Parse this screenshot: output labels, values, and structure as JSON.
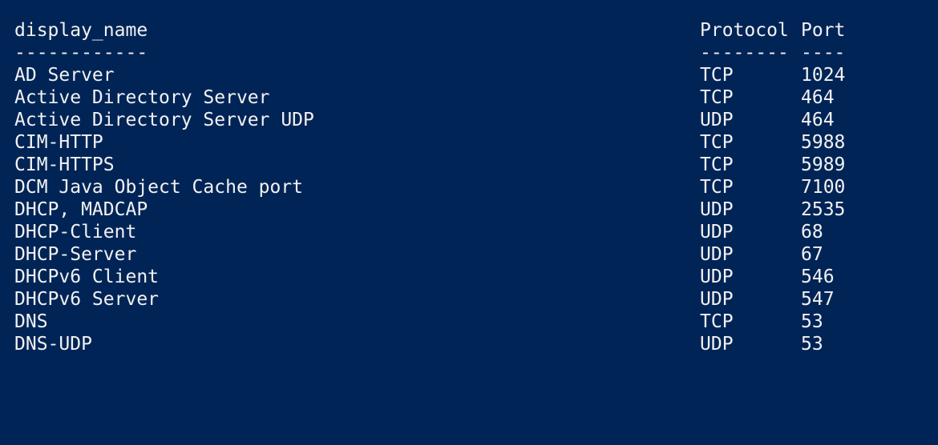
{
  "terminal": {
    "background_color": "#012456",
    "text_color": "#f2f2f2",
    "headers": {
      "display_name": "display_name",
      "protocol": "Protocol",
      "port": "Port"
    },
    "separators": {
      "display_name": "------------",
      "protocol": "--------",
      "port": "----"
    },
    "rows": [
      {
        "display_name": "AD Server",
        "protocol": "TCP",
        "port": "1024"
      },
      {
        "display_name": "Active Directory Server",
        "protocol": "TCP",
        "port": "464"
      },
      {
        "display_name": "Active Directory Server UDP",
        "protocol": "UDP",
        "port": "464"
      },
      {
        "display_name": "CIM-HTTP",
        "protocol": "TCP",
        "port": "5988"
      },
      {
        "display_name": "CIM-HTTPS",
        "protocol": "TCP",
        "port": "5989"
      },
      {
        "display_name": "DCM Java Object Cache port",
        "protocol": "TCP",
        "port": "7100"
      },
      {
        "display_name": "DHCP, MADCAP",
        "protocol": "UDP",
        "port": "2535"
      },
      {
        "display_name": "DHCP-Client",
        "protocol": "UDP",
        "port": "68"
      },
      {
        "display_name": "DHCP-Server",
        "protocol": "UDP",
        "port": "67"
      },
      {
        "display_name": "DHCPv6 Client",
        "protocol": "UDP",
        "port": "546"
      },
      {
        "display_name": "DHCPv6 Server",
        "protocol": "UDP",
        "port": "547"
      },
      {
        "display_name": "DNS",
        "protocol": "TCP",
        "port": "53"
      },
      {
        "display_name": "DNS-UDP",
        "protocol": "UDP",
        "port": "53"
      }
    ]
  }
}
